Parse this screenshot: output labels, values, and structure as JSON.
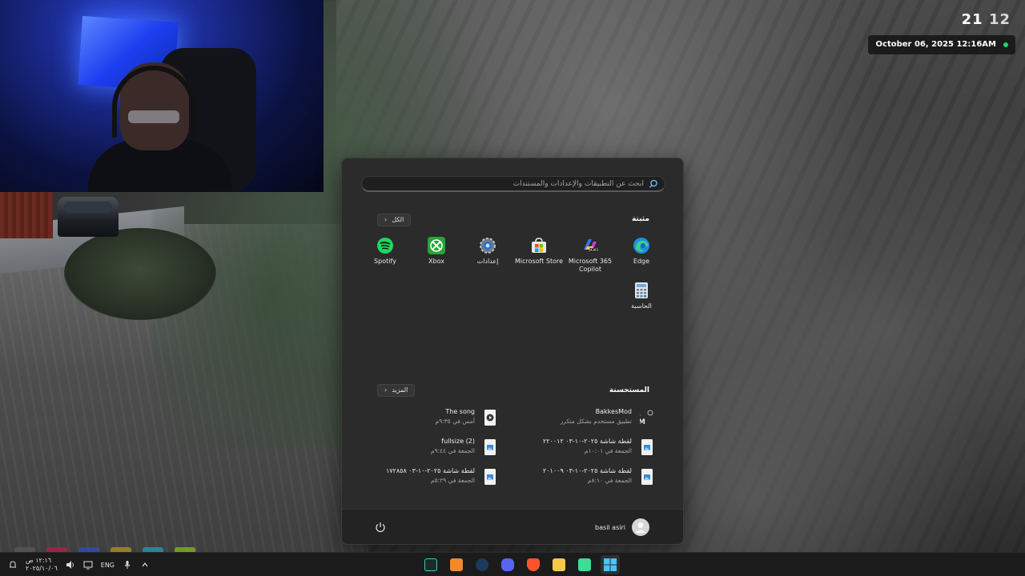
{
  "hud": {
    "time_hours": "21",
    "time_minutes": "12",
    "date": "October 06, 2025 12:16AM",
    "status_color": "#22d46b"
  },
  "start_menu": {
    "search": {
      "placeholder": "ابحث عن التطبيقات والإعدادات والمستندات",
      "icon": "search-icon"
    },
    "pinned": {
      "title": "مثبتة",
      "all_button": "الكل",
      "apps": [
        {
          "label": "Edge",
          "icon": "edge-icon"
        },
        {
          "label": "Microsoft 365 Copilot",
          "icon": "m365-copilot-icon"
        },
        {
          "label": "Microsoft Store",
          "icon": "store-icon"
        },
        {
          "label": "إعدادات",
          "icon": "settings-gear-icon"
        },
        {
          "label": "Xbox",
          "icon": "xbox-icon"
        },
        {
          "label": "Spotify",
          "icon": "spotify-icon"
        },
        {
          "label": "الحاسبة",
          "icon": "calculator-icon"
        }
      ]
    },
    "recommended": {
      "title": "المستحسنة",
      "more_button": "المزيد",
      "items": [
        {
          "name": "BakkesMod",
          "sub": "تطبيق مستخدم بشكل متكرر",
          "icon": "bakkesmod-icon"
        },
        {
          "name": "The song",
          "sub": "أمس في ٩:٣٥م",
          "icon": "media-file-icon"
        },
        {
          "name": "لقطة شاشة ٢٠٢٥-١٠-٠٣ ٢٢٠٠١٢",
          "sub": "الجمعة في ١٠:٠١م",
          "icon": "image-file-icon"
        },
        {
          "name": "fullsize (2)",
          "sub": "الجمعة في ٩:٤٤م",
          "icon": "image-file-icon"
        },
        {
          "name": "لقطة شاشة ٢٠٢٥-١٠-٠٣ ٢٠١٠٠٩",
          "sub": "الجمعة في ٨:١٠م",
          "icon": "image-file-icon"
        },
        {
          "name": "لقطة شاشة ٢٠٢٥-١٠-٠٣ ١٧٢٨٥٨",
          "sub": "الجمعة في ٥:٢٩م",
          "icon": "image-file-icon"
        }
      ]
    },
    "user": {
      "name": "basil asiri"
    }
  },
  "taskbar": {
    "clock_time": "١٢:١٦ ص",
    "clock_date": "٢٠٢٥/١٠/٠٦",
    "language": "ENG",
    "apps": [
      {
        "icon": "game-launcher-icon"
      },
      {
        "icon": "ableton-icon"
      },
      {
        "icon": "steam-icon"
      },
      {
        "icon": "discord-icon"
      },
      {
        "icon": "brave-icon"
      },
      {
        "icon": "file-explorer-icon"
      },
      {
        "icon": "android-app-icon"
      },
      {
        "icon": "windows-start-icon"
      }
    ]
  }
}
